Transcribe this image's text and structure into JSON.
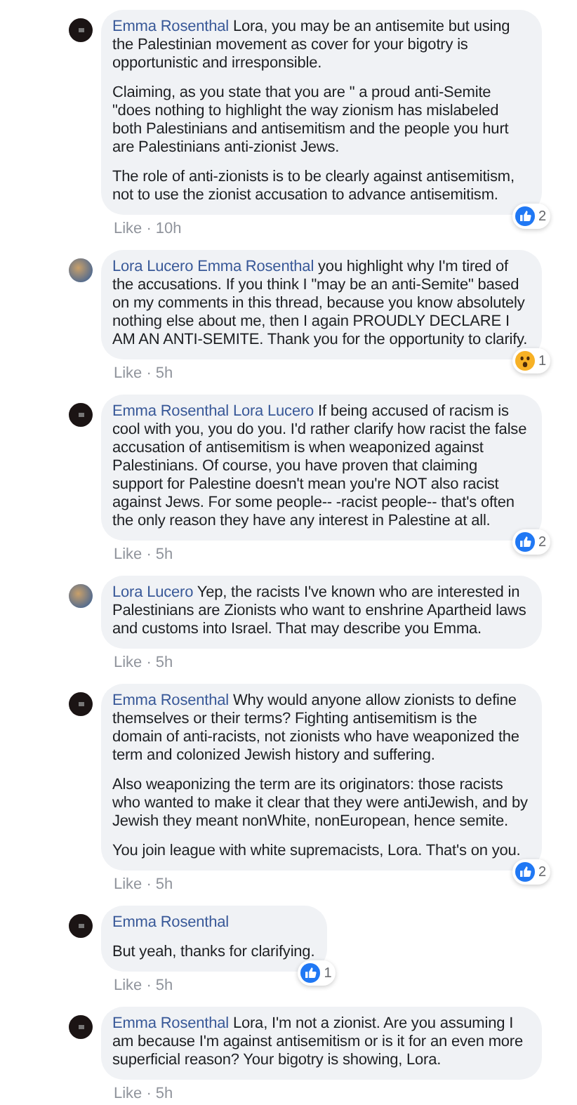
{
  "comments": [
    {
      "author": "Emma Rosenthal",
      "name_on_own_line": false,
      "paragraphs": [
        "Lora, you may be an antisemite but using the Palestinian movement as cover for your bigotry is opportunistic and irresponsible.",
        "Claiming, as you state that you are \" a proud anti-Semite \"does nothing to highlight the way zionism has mislabeled both Palestinians and antisemitism and the people you hurt are Palestinians anti-zionist Jews.",
        "The role of anti-zionists is to be clearly against antisemitism, not to use the zionist accusation to advance antisemitism."
      ],
      "like": "Like",
      "separator": "·",
      "time": "10h",
      "reaction": {
        "kind": "like",
        "count": "2"
      }
    },
    {
      "author": "Lora Lucero",
      "mention": "Emma Rosenthal",
      "name_on_own_line": false,
      "paragraphs": [
        "you highlight why I'm tired of the accusations. If you think I \"may be an anti-Semite\" based on my comments in this thread, because you know absolutely nothing else about me, then I again PROUDLY DECLARE I AM AN ANTI-SEMITE. Thank you for the opportunity to clarify."
      ],
      "like": "Like",
      "separator": "·",
      "time": "5h",
      "reaction": {
        "kind": "wow",
        "count": "1"
      }
    },
    {
      "author": "Emma Rosenthal",
      "mention": "Lora Lucero",
      "name_on_own_line": false,
      "paragraphs": [
        "If being accused of racism is cool with you, you do you. I'd rather clarify how racist the false accusation of antisemitism is when weaponized against Palestinians. Of course, you have proven that claiming support for Palestine doesn't mean you're NOT also racist against Jews. For some people-- -racist people-- that's often the only reason they have any interest in Palestine at all."
      ],
      "like": "Like",
      "separator": "·",
      "time": "5h",
      "reaction": {
        "kind": "like",
        "count": "2"
      }
    },
    {
      "author": "Lora Lucero",
      "name_on_own_line": false,
      "paragraphs": [
        "Yep, the racists I've known who are interested in Palestinians are Zionists who want to enshrine Apartheid laws and customs into Israel. That may describe you Emma."
      ],
      "like": "Like",
      "separator": "·",
      "time": "5h"
    },
    {
      "author": "Emma Rosenthal",
      "name_on_own_line": false,
      "paragraphs": [
        "Why would anyone allow zionists to define themselves or their terms? Fighting antisemitism is the domain of anti-racists, not zionists who have weaponized the term and colonized Jewish history and suffering.",
        "Also weaponizing the term are its originators: those racists who wanted to make it clear that they were antiJewish, and by Jewish they meant nonWhite, nonEuropean, hence semite.",
        "You join league with white supremacists, Lora. That's on you."
      ],
      "like": "Like",
      "separator": "·",
      "time": "5h",
      "reaction": {
        "kind": "like",
        "count": "2"
      }
    },
    {
      "author": "Emma Rosenthal",
      "name_on_own_line": true,
      "paragraphs": [
        "But yeah, thanks for clarifying."
      ],
      "like": "Like",
      "separator": "·",
      "time": "5h",
      "reaction": {
        "kind": "like",
        "count": "1"
      }
    },
    {
      "author": "Emma Rosenthal",
      "name_on_own_line": false,
      "paragraphs": [
        "Lora, I'm not a zionist. Are you assuming I am because I'm against antisemitism or is it for an even more superficial reason? Your bigotry is showing, Lora."
      ],
      "like": "Like",
      "separator": "·",
      "time": "5h"
    }
  ]
}
